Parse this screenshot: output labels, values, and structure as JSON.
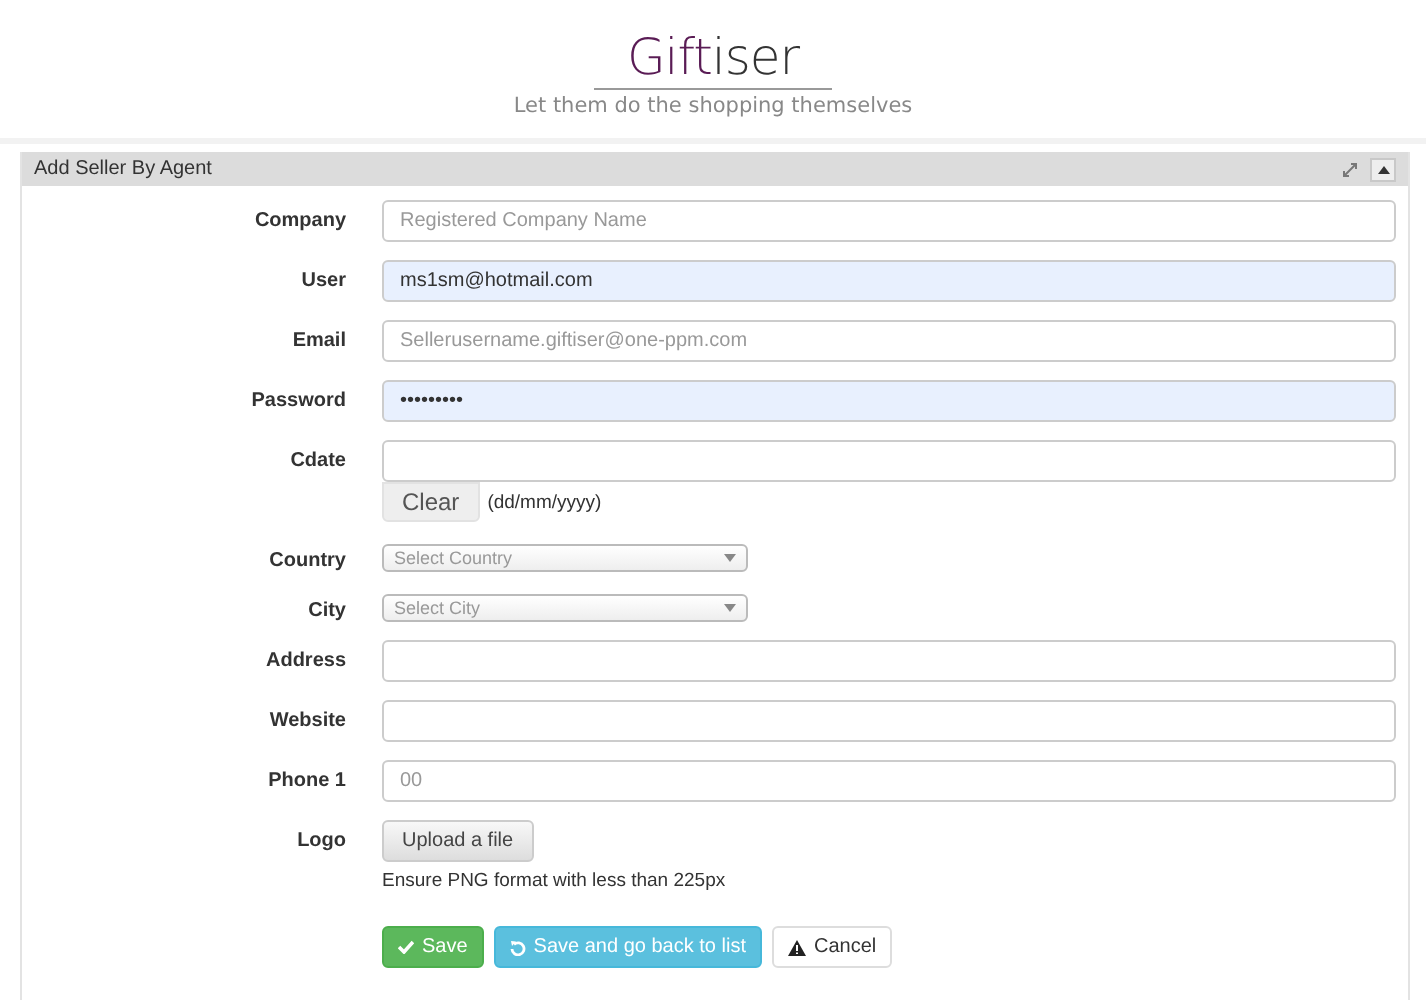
{
  "header": {
    "logo_primary": "Gift",
    "logo_secondary": "iser",
    "tagline": "Let them do the shopping themselves"
  },
  "panel": {
    "title": "Add Seller By Agent"
  },
  "fields": [
    {
      "kind": "text",
      "label": "Company",
      "placeholder": "Registered Company Name",
      "highlighted": false
    },
    {
      "kind": "text",
      "label": "User",
      "value": "ms1sm@hotmail.com",
      "highlighted": true
    },
    {
      "kind": "text",
      "label": "Email",
      "placeholder": "Sellerusername.giftiser@one-ppm.com",
      "highlighted": false
    },
    {
      "kind": "text",
      "label": "Password",
      "value": "•••••••••",
      "highlighted": true
    },
    {
      "kind": "date",
      "label": "Cdate",
      "button": "Clear",
      "hint": "(dd/mm/yyyy)"
    },
    {
      "kind": "select",
      "label": "Country",
      "placeholder": "Select Country"
    },
    {
      "kind": "select",
      "label": "City",
      "placeholder": "Select City"
    },
    {
      "kind": "text",
      "label": "Address",
      "highlighted": false
    },
    {
      "kind": "text",
      "label": "Website",
      "highlighted": false
    },
    {
      "kind": "text",
      "label": "Phone 1",
      "placeholder": "00",
      "highlighted": false
    },
    {
      "kind": "file",
      "label": "Logo",
      "button": "Upload a file",
      "hint": "Ensure PNG format with less than 225px"
    }
  ],
  "actions": [
    {
      "kind": "save",
      "label": "Save"
    },
    {
      "kind": "back",
      "label": "Save and go back to list"
    },
    {
      "kind": "cancel",
      "label": "Cancel"
    }
  ]
}
